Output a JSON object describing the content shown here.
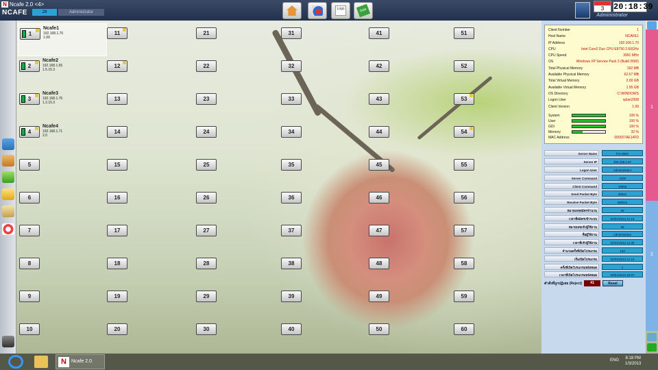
{
  "titlebar": {
    "title": "Ncafe 2.0 <4>",
    "logo": "NCAFE",
    "count": "29",
    "user": "Administrator"
  },
  "toolbar": [
    {
      "name": "home-icon"
    },
    {
      "name": "monitor-chart-icon"
    },
    {
      "name": "logo-icon",
      "label": "Logo"
    },
    {
      "name": "sale-icon",
      "label": "Sale"
    }
  ],
  "header_right": {
    "day": "3",
    "time": "20:18:39",
    "user": "Administrator"
  },
  "clients": [
    {
      "number": "1",
      "name": "Ncafe1",
      "ip": "192.168.1.70",
      "ver": "1.99",
      "active": true,
      "on": true
    },
    {
      "number": "2",
      "name": "Ncafe2",
      "ip": "192.168.1.65",
      "ver": "1.5.15.3",
      "active": false,
      "on": true
    },
    {
      "number": "3",
      "name": "Ncafe3",
      "ip": "192.168.1.76",
      "ver": "1.3.15.3",
      "active": false,
      "on": true
    },
    {
      "number": "4",
      "name": "Ncafe4",
      "ip": "192.168.1.71",
      "ver": "2.0",
      "active": false,
      "on": true
    }
  ],
  "client_numbers": [
    "1",
    "2",
    "3",
    "4",
    "5",
    "6",
    "7",
    "8",
    "9",
    "10",
    "11",
    "12",
    "13",
    "14",
    "15",
    "16",
    "17",
    "18",
    "19",
    "20",
    "21",
    "22",
    "23",
    "24",
    "25",
    "26",
    "27",
    "28",
    "29",
    "30",
    "31",
    "32",
    "33",
    "34",
    "35",
    "36",
    "37",
    "38",
    "39",
    "40",
    "41",
    "42",
    "43",
    "44",
    "45",
    "46",
    "47",
    "48",
    "49",
    "50",
    "51",
    "52",
    "53",
    "54",
    "55",
    "56",
    "57",
    "58",
    "59",
    "60"
  ],
  "info": {
    "rows": [
      {
        "k": "Client Number",
        "v": "1"
      },
      {
        "k": "Host Name",
        "v": "NCAFE1"
      },
      {
        "k": "IP Address",
        "v": "192.168.1.70"
      },
      {
        "k": "CPU",
        "v": "Intel Core2 Duo CPU E8750 2.66GHz"
      },
      {
        "k": "CPU Speed",
        "v": "3991 MHz"
      },
      {
        "k": "OS",
        "v": "Windows XP Service Pack 3 (Build 2600)"
      },
      {
        "k": "Total Physical Memory",
        "v": "192 MB"
      },
      {
        "k": "Available Physical Memory",
        "v": "62.67 MB"
      },
      {
        "k": "Total Virtual Memory",
        "v": "2.00 GB"
      },
      {
        "k": "Available Virtual Memory",
        "v": "1.95 GB"
      },
      {
        "k": "OS Directory",
        "v": "C:\\WINDOWS"
      },
      {
        "k": "Logon User",
        "v": "xplan2008"
      },
      {
        "k": "Client Version",
        "v": "1.99"
      }
    ],
    "bars": [
      {
        "k": "System",
        "p": "100 %",
        "v": 1.0
      },
      {
        "k": "User",
        "p": "100 %",
        "v": 1.0
      },
      {
        "k": "GDI",
        "p": "100 %",
        "v": 1.0
      },
      {
        "k": "Memory",
        "p": "32 %",
        "v": 0.32
      }
    ],
    "mac_label": "MAC Address",
    "mac": "000027AE14FD"
  },
  "stats": [
    {
      "k": "Server Name",
      "v": "PS-NMO"
    },
    {
      "k": "Server IP",
      "v": "192.168.1.67"
    },
    {
      "k": "Logon User",
      "v": "Administrator"
    },
    {
      "k": "Server Command",
      "v": "1200"
    },
    {
      "k": "Client Command",
      "v": "19958"
    },
    {
      "k": "Send Packet Byte",
      "v": "40621"
    },
    {
      "k": "Receive Packet Byte",
      "v": "480621"
    },
    {
      "k": "หมายเลขสมัครจำนวน",
      "v": "29"
    },
    {
      "k": "เวลาที่สมัครเข้าระบบ",
      "v": "02/01/2013 11:16"
    },
    {
      "k": "หมายเลขเข้าผู้ใช้งาน",
      "v": "29"
    },
    {
      "k": "ชื่อผู้ใช้งาน",
      "v": "Administrator"
    },
    {
      "k": "เวลาที่เข้าผู้ใช้งาน",
      "v": "02/01/2013 11:30"
    },
    {
      "k": "จำนวนครั้งที่เปิดโปรแกรม",
      "v": "133"
    },
    {
      "k": "เริ่มเปิดโปรแกรม",
      "v": "02/01/2013 11:10"
    },
    {
      "k": "ครั้งที่เปิดโปรแกรมหลังหมด",
      "v": "1"
    },
    {
      "k": "เวลาที่เปิดโปรแกรมหลังหมด",
      "v": "03/01/2013 20:07"
    }
  ],
  "reject": {
    "label": "คำสั่งที่ถูกปฏิเสธ (Reject)",
    "value": "41",
    "button": "Reset"
  },
  "strip": {
    "tab1": "1",
    "tab2": "2"
  },
  "taskbar": {
    "app": "Ncafe 2.0",
    "lang": "ENG",
    "time": "8:18 PM",
    "date": "1/3/2013"
  }
}
